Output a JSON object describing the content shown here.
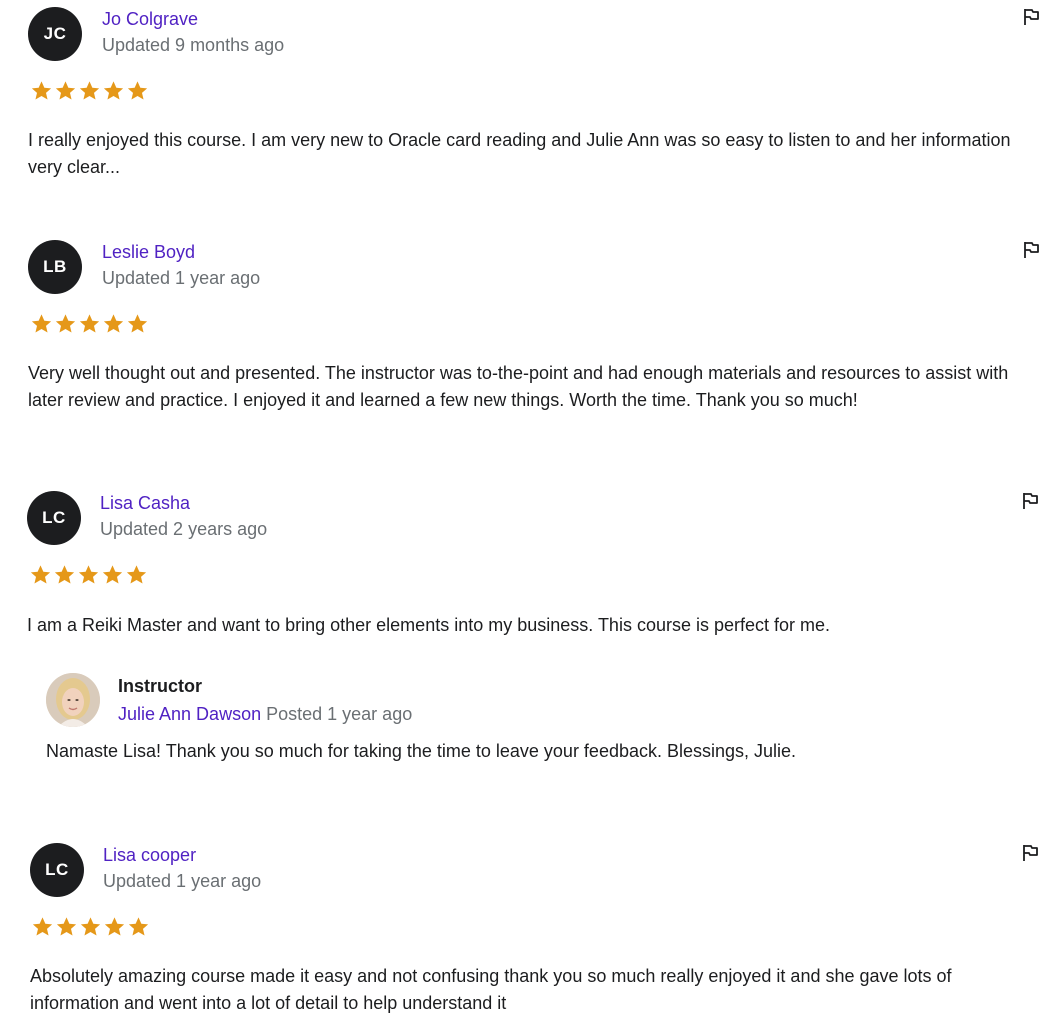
{
  "colors": {
    "name_link": "#5022c3",
    "meta_gray": "#6a6f73",
    "star": "#e59819",
    "avatar_bg": "#1c1d1f",
    "text": "#1c1d1f"
  },
  "reviews": [
    {
      "initials": "JC",
      "name": "Jo Colgrave",
      "updated": "Updated 9 months ago",
      "rating": 5,
      "text_lines": [
        "I really enjoyed this course. I am very new to Oracle card reading and Julie Ann was so easy to listen to and her information",
        "very clear..."
      ],
      "flag_icon": "flag-icon"
    },
    {
      "initials": "LB",
      "name": "Leslie Boyd",
      "updated": "Updated 1 year ago",
      "rating": 5,
      "text_lines": [
        "Very well thought out and presented. The instructor was to-the-point and had enough materials and resources to assist with",
        "later review and practice. I enjoyed it and learned a few new things. Worth the time. Thank you so much!"
      ],
      "flag_icon": "flag-icon"
    },
    {
      "initials": "LC",
      "name": "Lisa Casha",
      "updated": "Updated 2 years ago",
      "rating": 5,
      "text_lines": [
        "I am a Reiki Master and want to bring other elements into my business. This course is perfect for me."
      ],
      "flag_icon": "flag-icon",
      "reply": {
        "title": "Instructor",
        "instructor_name": "Julie Ann Dawson",
        "posted": "Posted 1 year ago",
        "text": "Namaste Lisa! Thank you so much for taking the time to leave your feedback. Blessings, Julie."
      }
    },
    {
      "initials": "LC",
      "name": "Lisa cooper",
      "updated": "Updated 1 year ago",
      "rating": 5,
      "text_lines": [
        "Absolutely amazing course made it easy and not confusing thank you so much really enjoyed it and she gave lots of",
        "information and went into a lot of detail to help understand it"
      ],
      "flag_icon": "flag-icon"
    }
  ]
}
